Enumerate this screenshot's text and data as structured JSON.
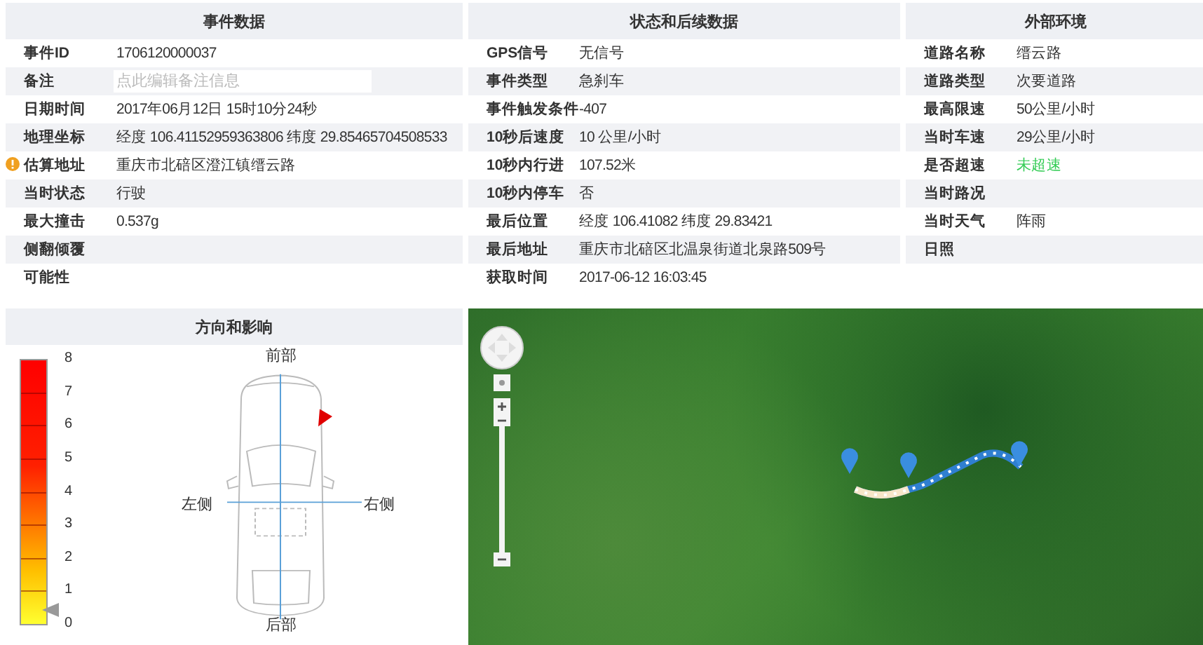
{
  "panels": [
    {
      "title": "事件数据",
      "rows": [
        {
          "kind": "text",
          "label": "事件ID",
          "value": "1706120000037"
        },
        {
          "kind": "field",
          "label": "备注",
          "placeholder": "点此编辑备注信息"
        },
        {
          "kind": "text",
          "label": "日期时间",
          "value": "2017年06月12日 15时10分24秒"
        },
        {
          "kind": "text",
          "label": "地理坐标",
          "value": "经度 106.41152959363806  纬度 29.85465704508533"
        },
        {
          "kind": "warning",
          "label": "估算地址",
          "value": "重庆市北碚区澄江镇缙云路"
        },
        {
          "kind": "text",
          "label": "当时状态",
          "value": "行驶"
        },
        {
          "kind": "text",
          "label": "最大撞击",
          "value": "0.537g"
        },
        {
          "kind": "text",
          "label": "侧翻倾覆"
        },
        {
          "kind": "text",
          "label": "可能性"
        }
      ]
    },
    {
      "title": "状态和后续数据",
      "rows": [
        {
          "kind": "text",
          "label": "GPS信号",
          "value": "无信号"
        },
        {
          "kind": "text",
          "label": "事件类型",
          "value": "急刹车"
        },
        {
          "kind": "text",
          "label": "事件触发条件",
          "value": "-407"
        },
        {
          "kind": "text",
          "label": "10秒后速度",
          "value": "10 公里/小时"
        },
        {
          "kind": "text",
          "label": "10秒内行进",
          "value": "107.52米"
        },
        {
          "kind": "text",
          "label": "10秒内停车",
          "value": "否"
        },
        {
          "kind": "text",
          "label": "最后位置",
          "value": "经度 106.41082  纬度 29.83421"
        },
        {
          "kind": "text",
          "label": "最后地址",
          "value": "重庆市北碚区北温泉街道北泉路509号"
        },
        {
          "kind": "text",
          "label": "获取时间",
          "value": "2017-06-12 16:03:45"
        }
      ]
    },
    {
      "title": "外部环境",
      "rows": [
        {
          "kind": "text",
          "label": "道路名称",
          "value": "缙云路"
        },
        {
          "kind": "text",
          "label": "道路类型",
          "value": "次要道路"
        },
        {
          "kind": "text",
          "label": "最高限速",
          "value": "50公里/小时"
        },
        {
          "kind": "text",
          "label": "当时车速",
          "value": "29公里/小时"
        },
        {
          "kind": "text",
          "label": "是否超速",
          "value": "未超速",
          "color": "#33cc55"
        },
        {
          "kind": "text",
          "label": "当时路况"
        },
        {
          "kind": "text",
          "label": "当时天气",
          "value": "阵雨"
        },
        {
          "kind": "text",
          "label": "日照"
        }
      ]
    }
  ],
  "impact": {
    "title": "方向和影响",
    "scale": [
      "8",
      "7",
      "6",
      "5",
      "4",
      "3",
      "2",
      "1",
      "0"
    ],
    "level": 0.06,
    "directions": {
      "front": "前部",
      "rear": "后部",
      "left": "左侧",
      "right": "右侧"
    }
  }
}
